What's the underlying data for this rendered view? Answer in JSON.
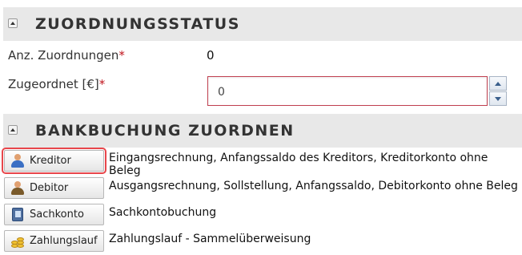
{
  "status_section": {
    "title": "ZUORDNUNGSSTATUS",
    "count_label": "Anz. Zuordnungen",
    "count_required": "*",
    "count_value": "0",
    "assigned_label": "Zugeordnet [€]",
    "assigned_required": "*",
    "assigned_value": "0"
  },
  "assign_section": {
    "title": "BANKBUCHUNG ZUORDNEN",
    "actions": [
      {
        "label": "Kreditor",
        "icon": "creditor-person-icon",
        "description": "Eingangsrechnung, Anfangssaldo des Kreditors, Kreditorkonto ohne Beleg",
        "selected": true
      },
      {
        "label": "Debitor",
        "icon": "debitor-person-icon",
        "description": "Ausgangsrechnung, Sollstellung, Anfangssaldo, Debitorkonto ohne Beleg",
        "selected": false
      },
      {
        "label": "Sachkonto",
        "icon": "ledger-book-icon",
        "description": "Sachkontobuchung",
        "selected": false
      },
      {
        "label": "Zahlungslauf",
        "icon": "coins-icon",
        "description": "Zahlungslauf - Sammelüberweisung",
        "selected": false
      }
    ]
  },
  "colors": {
    "header_bg": "#e8e8e8",
    "required": "#c0141c",
    "invalid_border": "#c04050",
    "selected_outline": "#e8464b"
  }
}
